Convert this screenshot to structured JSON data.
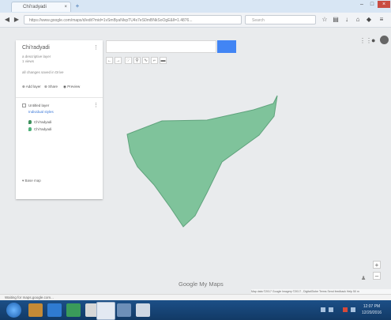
{
  "browser": {
    "tab_title": "Chi'radyadi",
    "tab_close": "×",
    "new_tab": "+",
    "window_buttons": {
      "minimize": "–",
      "maximize": "□",
      "close": "×"
    },
    "back": "◀",
    "forward": "▶",
    "url": "https://www.google.com/maps/d/edit?mid=1vSmByaNlvpTU4x7eS0mBNkSoOgE&ll=1.4876...",
    "search_placeholder": "Search",
    "toolbar_icons": [
      "star-icon",
      "bookmark-icon",
      "download-icon",
      "home-icon",
      "shield-icon",
      "menu-icon"
    ]
  },
  "map_editor": {
    "map_title": "Chi'radyadi",
    "map_subtitle_1": "a descriptive layer",
    "map_subtitle_2": "1 views",
    "map_description": "all changes saved in Drive",
    "actions": [
      "Add layer",
      "Share",
      "Preview"
    ],
    "layer_title": "Untitled layer",
    "layer_style": "Individual styles",
    "features": [
      "Chi'radyadi",
      "Chi'radyadi"
    ],
    "basemap_label": "Base map",
    "search_placeholder": "",
    "tools": [
      "←",
      "→",
      "☞",
      "⚲",
      "∿",
      "⌐",
      "▬"
    ]
  },
  "map": {
    "polygon_color": "#7fc39b",
    "polygon_stroke": "#5fa37c",
    "background_color": "#e9ebed",
    "logo_text": "Google My Maps",
    "attribution": "Map data ©2017 Google Imagery ©2017 , DigitalGlobe  Terms  Send feedback  Help  50 m",
    "zoom_in": "+",
    "zoom_out": "–",
    "status_text": "Waiting for maps.google.com..."
  },
  "taskbar": {
    "clock_time": "12:07 PM",
    "clock_date": "12/20/2016"
  }
}
